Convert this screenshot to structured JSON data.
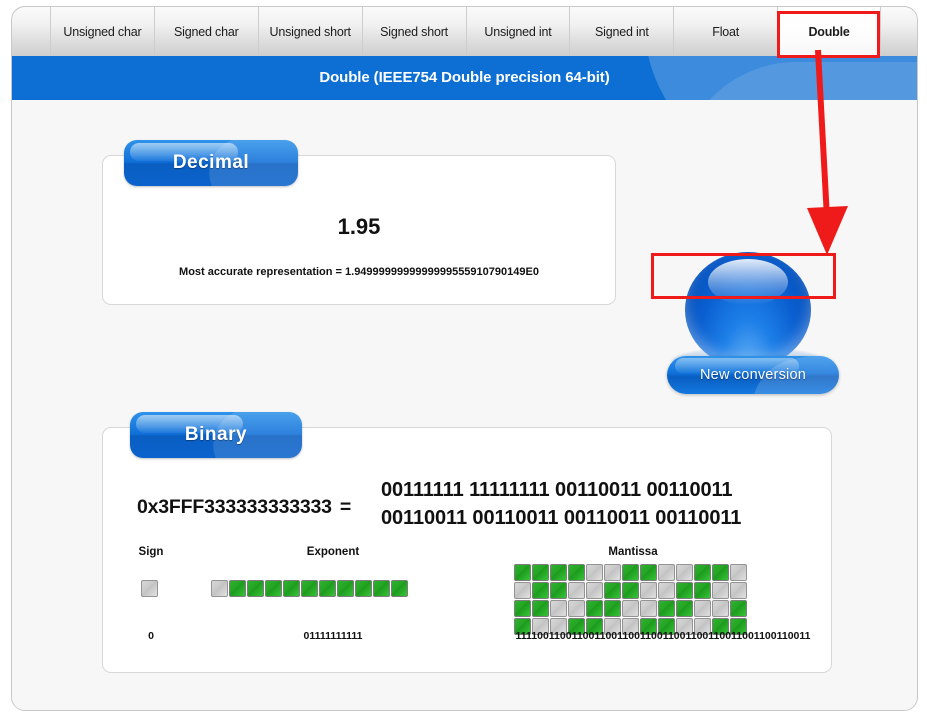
{
  "tabs": [
    {
      "label": "Unsigned char",
      "active": false
    },
    {
      "label": "Signed char",
      "active": false
    },
    {
      "label": "Unsigned short",
      "active": false
    },
    {
      "label": "Signed short",
      "active": false
    },
    {
      "label": "Unsigned int",
      "active": false
    },
    {
      "label": "Signed int",
      "active": false
    },
    {
      "label": "Float",
      "active": false
    },
    {
      "label": "Double",
      "active": true
    }
  ],
  "banner": {
    "title": "Double (IEEE754 Double precision 64-bit)"
  },
  "decimal": {
    "tab_label": "Decimal",
    "value": "1.95",
    "accurate_text": "Most accurate representation = 1.9499999999999999555910790149E0"
  },
  "actions": {
    "new_conversion_label": "New conversion"
  },
  "binary": {
    "tab_label": "Binary",
    "hex": "0x3FFF333333333333",
    "equals": "=",
    "bits_line1": "00111111 11111111 00110011 00110011",
    "bits_line2": "00110011 00110011 00110011 00110011",
    "sign": {
      "label": "Sign",
      "bits": "0",
      "squares": [
        0
      ]
    },
    "exponent": {
      "label": "Exponent",
      "bits": "01111111111",
      "squares": [
        0,
        1,
        1,
        1,
        1,
        1,
        1,
        1,
        1,
        1,
        1
      ]
    },
    "mantissa": {
      "label": "Mantissa",
      "bits": "1111001100110011001100110011001100110011001100110011",
      "columns": 13,
      "squares": [
        1,
        1,
        1,
        1,
        0,
        0,
        1,
        1,
        0,
        0,
        1,
        1,
        0,
        0,
        1,
        1,
        0,
        0,
        1,
        1,
        0,
        0,
        1,
        1,
        0,
        0,
        1,
        1,
        0,
        0,
        1,
        1,
        0,
        0,
        1,
        1,
        0,
        0,
        1,
        1,
        0,
        0,
        1,
        1,
        0,
        0,
        1,
        1,
        0,
        0,
        1,
        1
      ]
    }
  },
  "annotations": {
    "highlight_tab": "Double",
    "highlight_button": "New conversion",
    "arrow_color": "#ef1b1b"
  },
  "colors": {
    "banner_blue": "#0d6fd4",
    "tab_blue": "#0f6fd8",
    "bit_on_green": "#23a423",
    "bit_off_gray": "#c9c9c9",
    "annotation_red": "#ef1b1b"
  }
}
